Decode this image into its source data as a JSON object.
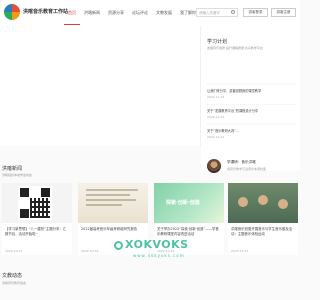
{
  "brand": {
    "title": "洪喀音乐教育工作站"
  },
  "nav": {
    "items": [
      {
        "label": "首页",
        "active": true
      },
      {
        "label": "洪喀新闻",
        "active": false
      },
      {
        "label": "资源分享",
        "active": false
      },
      {
        "label": "论坛评论",
        "active": false
      },
      {
        "label": "文教发展",
        "active": false
      },
      {
        "label": "我了解你",
        "active": false
      },
      {
        "label": "关于我们",
        "active": false
      }
    ]
  },
  "search": {
    "placeholder": "请输入关键字"
  },
  "header_buttons": {
    "login": "游客登录",
    "register": "游客注册"
  },
  "side": {
    "title": "学习计划",
    "subtitle": "发展音乐素质 提升课程质量 共享教学平台",
    "items": [
      {
        "title": "让我们来分享、游客回顾我的课堂教学",
        "date": "2022-11-07"
      },
      {
        "title": "关于“发展教育平台”的课程设计分享",
        "date": "2022-11-07"
      },
      {
        "title": "关于“音乐教研大赛”...",
        "date": "2022-10-21"
      }
    ],
    "author": {
      "name": "学课研：音乐洪喀",
      "desc": "用音乐教学沉浸音乐本源创造"
    }
  },
  "news": {
    "title": "洪喀新闻",
    "subtitle": "洪喀组织本地学会动态",
    "cards": [
      {
        "title": "【学习新思想】“八一建校”主题分享：汇报节目，活动开始啦~",
        "date": "2022-10-31",
        "image": "qr-code"
      },
      {
        "title": "2022届高考音乐年级考研组研究报告",
        "date": "2022-10-29",
        "image": "document"
      },
      {
        "title": "关于举办2022“探索·创新·创造”——学音乐教研课堂内容改进活动",
        "date": "2022-10-19",
        "image": "banner"
      },
      {
        "title": "洪喀音乐班委开展音乐与学生音乐普及活动：主题音乐体验运动",
        "date": "2022-10-11",
        "image": "photo"
      }
    ],
    "banner_text": "探索·创新·创造"
  },
  "lower_section": {
    "title": "文教动态",
    "subtitle": "洪喀音乐教育动态"
  },
  "watermark": {
    "main": "XOKVOKS",
    "sub": "www.xokyoks.com"
  },
  "colors": {
    "accent": "#e03c3c",
    "watermark": "#4dc3a4"
  }
}
